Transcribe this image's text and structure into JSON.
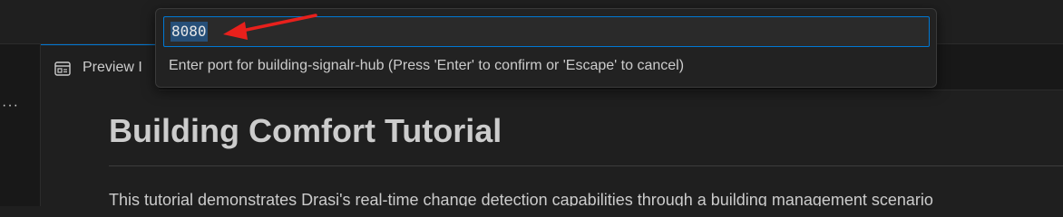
{
  "tab": {
    "label": "Preview I",
    "icon": "preview-icon"
  },
  "more_actions": "···",
  "document": {
    "title": "Building Comfort Tutorial",
    "paragraph": "This tutorial demonstrates Drasi's real-time change detection capabilities through a building management scenario"
  },
  "quick_input": {
    "value": "8080",
    "hint": "Enter port for building-signalr-hub (Press 'Enter' to confirm or 'Escape' to cancel)"
  },
  "annotation": {
    "arrow_color": "#e8201c"
  },
  "colors": {
    "accent": "#0078d4",
    "selection": "#264f78"
  }
}
